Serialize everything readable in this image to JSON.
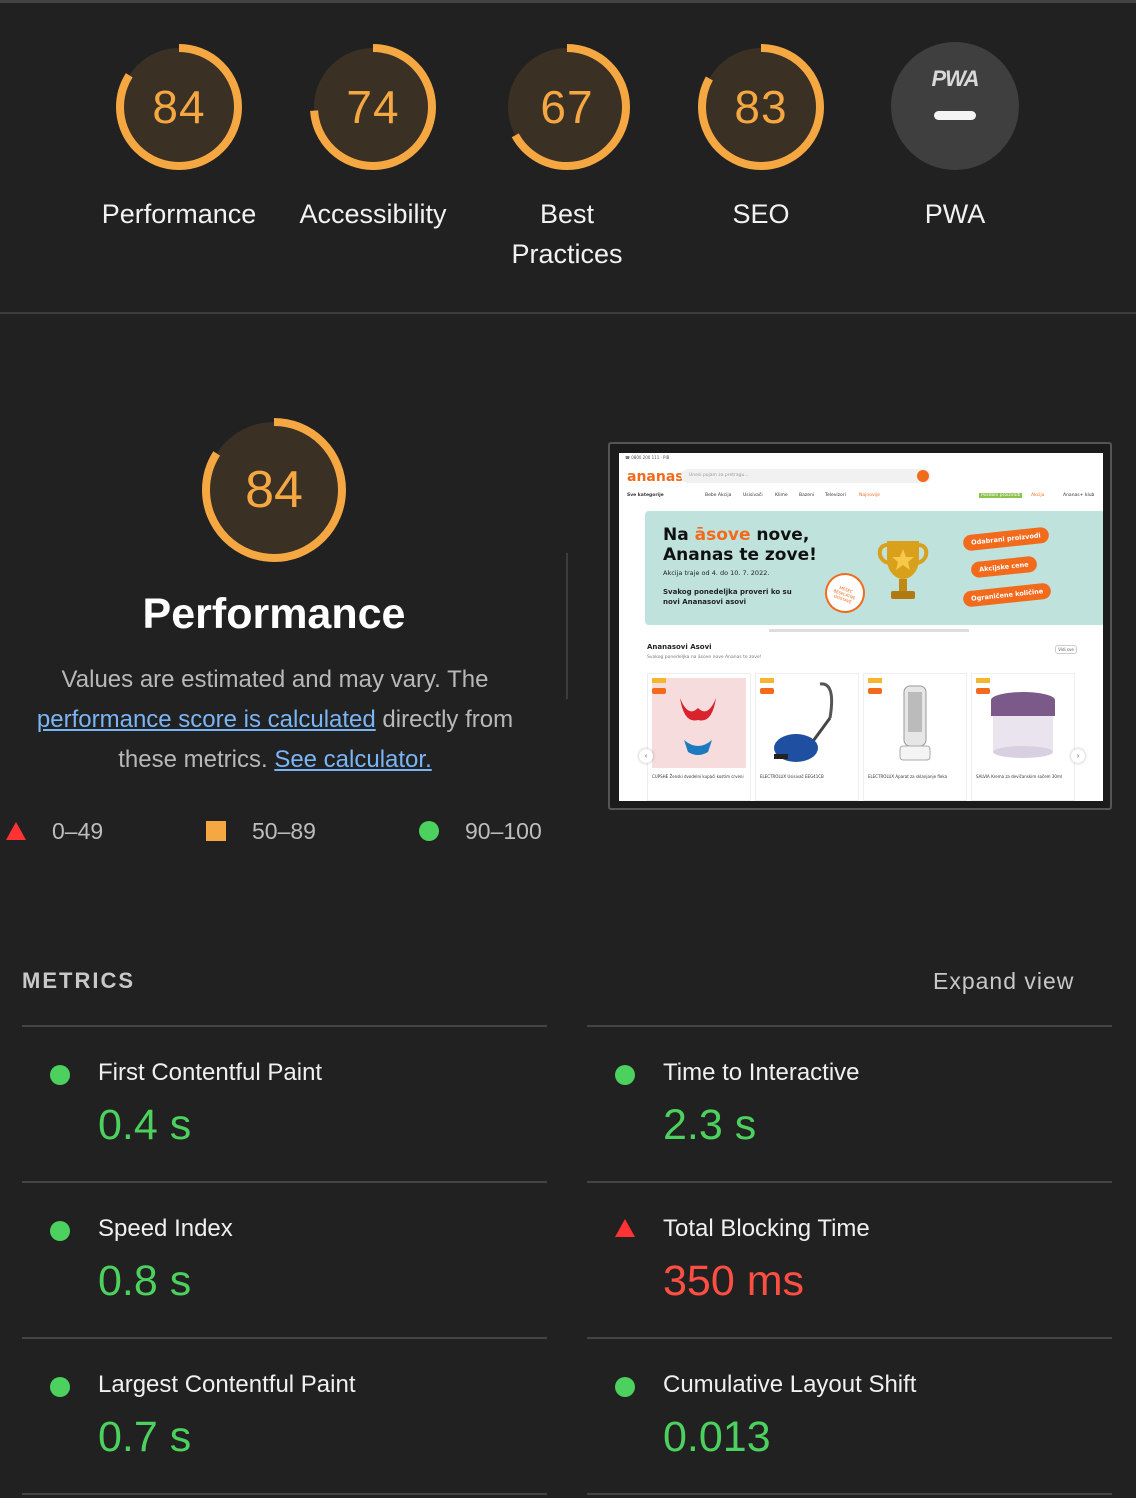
{
  "categories": [
    {
      "label": "Performance",
      "score": "84"
    },
    {
      "label": "Accessibility",
      "score": "74"
    },
    {
      "label": "Best Practices",
      "score": "67"
    },
    {
      "label": "SEO",
      "score": "83"
    },
    {
      "label": "PWA",
      "badge_text": "PWA"
    }
  ],
  "score_color": "#f5a742",
  "performance": {
    "score": "84",
    "title": "Performance",
    "desc_part1": "Values are estimated and may vary. The",
    "desc_link1": "performance score is calculated",
    "desc_part2": "directly from these metrics.",
    "desc_link2": "See calculator."
  },
  "legend": [
    {
      "shape": "triangle-red",
      "range": "0–49"
    },
    {
      "shape": "square-orange",
      "range": "50–89"
    },
    {
      "shape": "circle-green",
      "range": "90–100"
    }
  ],
  "screenshot": {
    "logo": "ananas",
    "search_placeholder": "Unesi pojam za pretragu...",
    "nav": [
      "Sve kategorije",
      "Bebe Akcija",
      "Usisivači",
      "Klime",
      "Bazeni",
      "Televizori",
      "Najnovije",
      "Posebni proizvodi",
      "Akcija",
      "Ananas+ klub"
    ],
    "banner_line1_a": "Na ",
    "banner_line1_b": "āsove",
    "banner_line1_c": " nove,",
    "banner_line2": "Ananas te zove!",
    "banner_dates": "Akcija traje od 4. do 10. 7. 2022.",
    "banner_sub": "Svakog ponedeljka proveri ko su novi Ananasovi asovi",
    "pills": [
      "Odabrani proizvodi",
      "Akcijske cene",
      "Ograničene količine"
    ],
    "seal": "MESEC BESPLATNE DOSTAVE",
    "section_title": "Ananasovi Asovi",
    "section_sub": "Svakog ponedeljka na āsove nove Ananas te zove!",
    "view_all": "Vidi sve",
    "products": [
      "CUPSHE Ženski dvodelni kupaći kostim crveni",
      "ELECTROLUX Usisivač EEG41CB",
      "ELECTROLUX Aparat za sklanjanje fleka",
      "SALVIA Krema za devičanskim sočem 30ml"
    ]
  },
  "metrics_header": "METRICS",
  "expand_label": "Expand view",
  "metrics": [
    {
      "name": "First Contentful Paint",
      "value": "0.4 s",
      "status": "good"
    },
    {
      "name": "Time to Interactive",
      "value": "2.3 s",
      "status": "good"
    },
    {
      "name": "Speed Index",
      "value": "0.8 s",
      "status": "good"
    },
    {
      "name": "Total Blocking Time",
      "value": "350 ms",
      "status": "bad"
    },
    {
      "name": "Largest Contentful Paint",
      "value": "0.7 s",
      "status": "good"
    },
    {
      "name": "Cumulative Layout Shift",
      "value": "0.013",
      "status": "good"
    }
  ]
}
